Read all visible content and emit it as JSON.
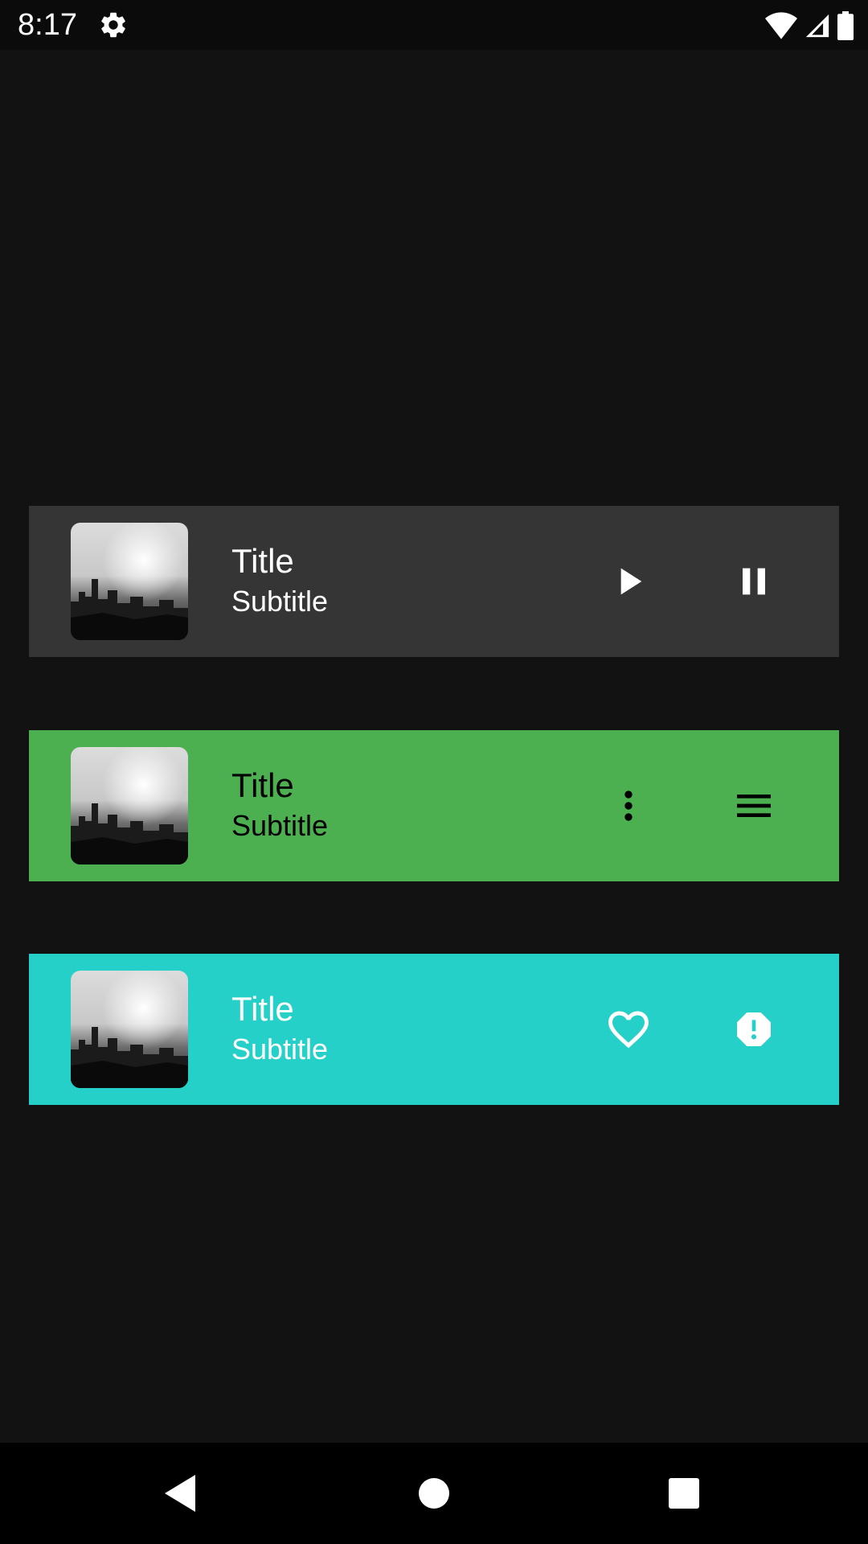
{
  "status_bar": {
    "time": "8:17",
    "icons": [
      "gear-icon",
      "wifi-icon",
      "cell-signal-icon",
      "battery-icon"
    ]
  },
  "cards": [
    {
      "title": "Title",
      "subtitle": "Subtitle",
      "background": "#353535",
      "text_color": "#ffffff",
      "icon_color": "#ffffff",
      "buttons": [
        "play-icon",
        "pause-icon"
      ]
    },
    {
      "title": "Title",
      "subtitle": "Subtitle",
      "background": "#4caf50",
      "text_color": "#000000",
      "icon_color": "#000000",
      "buttons": [
        "more-vert-icon",
        "menu-icon"
      ]
    },
    {
      "title": "Title",
      "subtitle": "Subtitle",
      "background": "#25d0c8",
      "text_color": "#ffffff",
      "icon_color": "#ffffff",
      "buttons": [
        "heart-outline-icon",
        "alert-octagon-icon"
      ]
    }
  ],
  "nav_bar": {
    "buttons": [
      "back-icon",
      "home-icon",
      "recents-icon"
    ]
  },
  "colors": {
    "app_background": "#121212",
    "status_bar": "#0b0b0b",
    "nav_bar": "#000000"
  }
}
